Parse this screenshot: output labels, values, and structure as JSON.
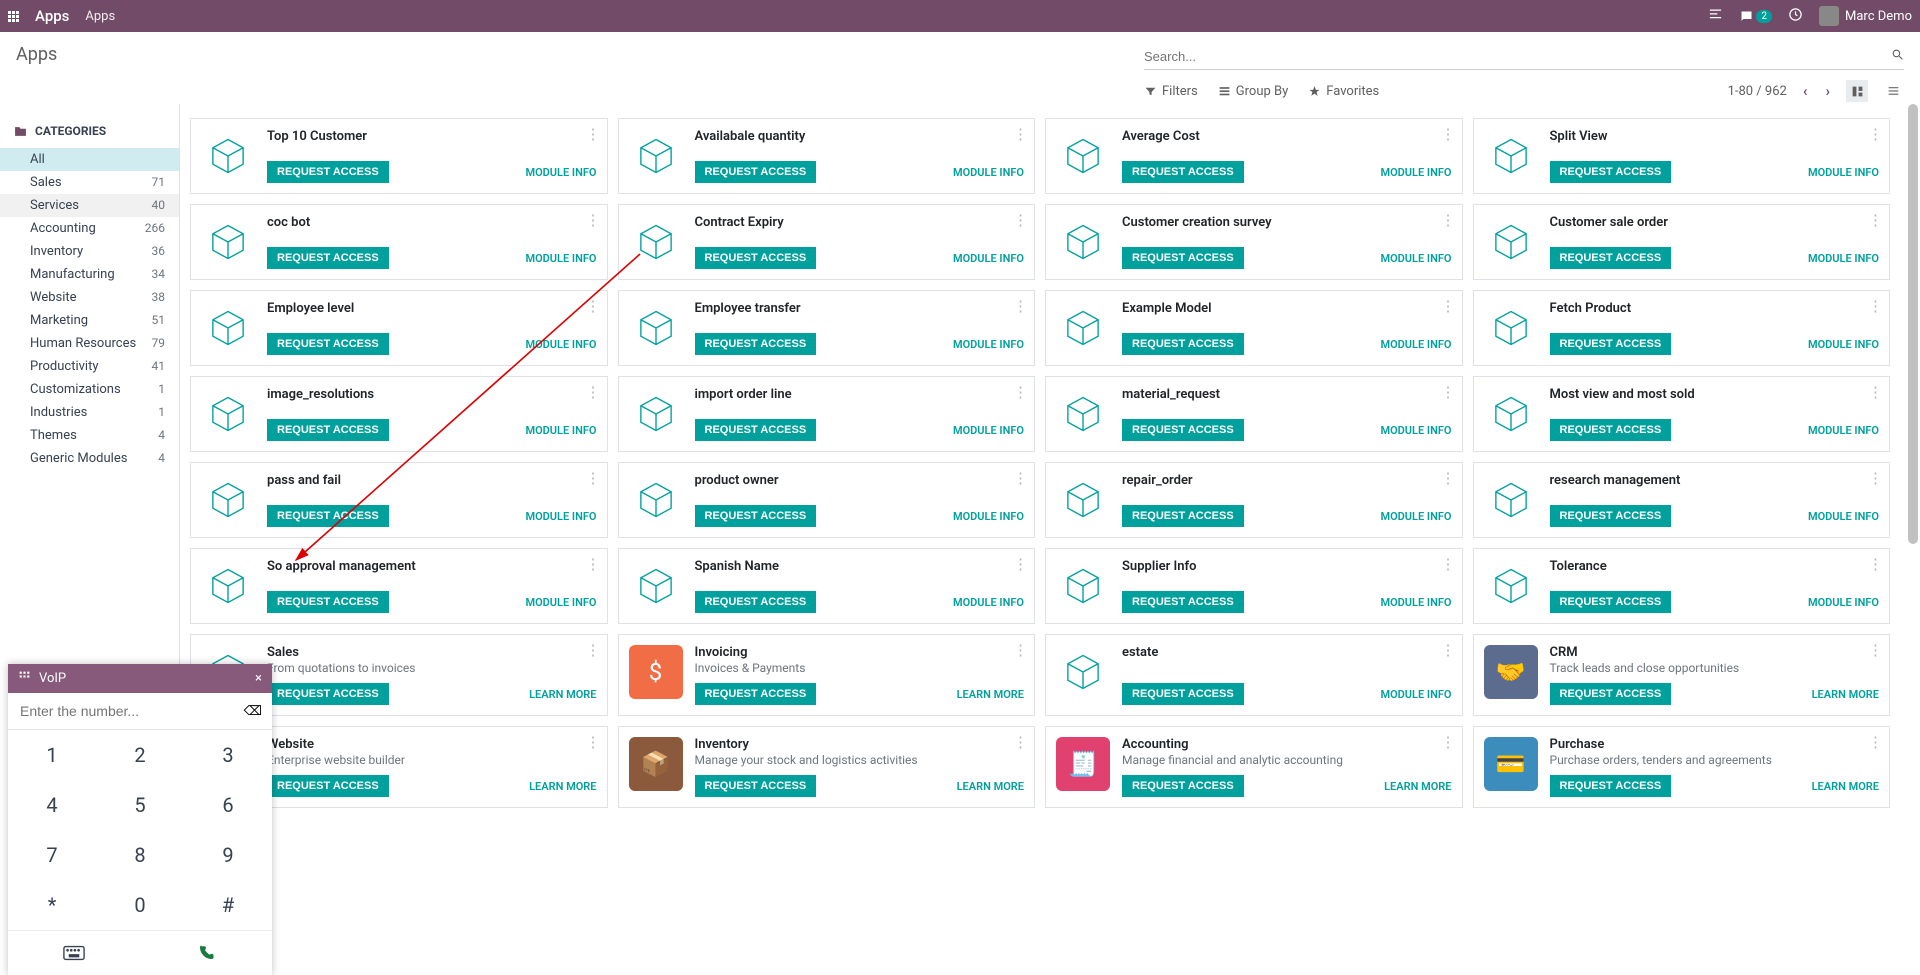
{
  "topbar": {
    "brand": "Apps",
    "crumb": "Apps",
    "user": "Marc Demo",
    "msg_badge": "2"
  },
  "page": {
    "title": "Apps",
    "search_placeholder": "Search..."
  },
  "controls": {
    "filters": "Filters",
    "groupby": "Group By",
    "favorites": "Favorites",
    "pager": "1-80 / 962"
  },
  "sidebar": {
    "header": "CATEGORIES",
    "items": [
      {
        "label": "All",
        "count": "",
        "sel": true
      },
      {
        "label": "Sales",
        "count": "71"
      },
      {
        "label": "Services",
        "count": "40",
        "hov": true
      },
      {
        "label": "Accounting",
        "count": "266"
      },
      {
        "label": "Inventory",
        "count": "36"
      },
      {
        "label": "Manufacturing",
        "count": "34"
      },
      {
        "label": "Website",
        "count": "38"
      },
      {
        "label": "Marketing",
        "count": "51"
      },
      {
        "label": "Human Resources",
        "count": "79"
      },
      {
        "label": "Productivity",
        "count": "41"
      },
      {
        "label": "Customizations",
        "count": "1"
      },
      {
        "label": "Industries",
        "count": "1"
      },
      {
        "label": "Themes",
        "count": "4"
      },
      {
        "label": "Generic Modules",
        "count": "4"
      }
    ]
  },
  "labels": {
    "request": "REQUEST ACCESS",
    "module_info": "MODULE INFO",
    "learn_more": "LEARN MORE"
  },
  "cards": [
    {
      "title": "Top 10 Customer",
      "link": "module_info",
      "icon": "cube"
    },
    {
      "title": "Availabale quantity",
      "link": "module_info",
      "icon": "cube"
    },
    {
      "title": "Average Cost",
      "link": "module_info",
      "icon": "cube"
    },
    {
      "title": "Split View",
      "link": "module_info",
      "icon": "cube"
    },
    {
      "title": "coc bot",
      "link": "module_info",
      "icon": "cube"
    },
    {
      "title": "Contract Expiry",
      "link": "module_info",
      "icon": "cube"
    },
    {
      "title": "Customer creation survey",
      "link": "module_info",
      "icon": "cube"
    },
    {
      "title": "Customer sale order",
      "link": "module_info",
      "icon": "cube"
    },
    {
      "title": "Employee level",
      "link": "module_info",
      "icon": "cube"
    },
    {
      "title": "Employee transfer",
      "link": "module_info",
      "icon": "cube"
    },
    {
      "title": "Example Model",
      "link": "module_info",
      "icon": "cube"
    },
    {
      "title": "Fetch Product",
      "link": "module_info",
      "icon": "cube"
    },
    {
      "title": "image_resolutions",
      "link": "module_info",
      "icon": "cube"
    },
    {
      "title": "import order line",
      "link": "module_info",
      "icon": "cube"
    },
    {
      "title": "material_request",
      "link": "module_info",
      "icon": "cube"
    },
    {
      "title": "Most view and most sold",
      "link": "module_info",
      "icon": "cube"
    },
    {
      "title": "pass and fail",
      "link": "module_info",
      "icon": "cube"
    },
    {
      "title": "product owner",
      "link": "module_info",
      "icon": "cube"
    },
    {
      "title": "repair_order",
      "link": "module_info",
      "icon": "cube"
    },
    {
      "title": "research management",
      "link": "module_info",
      "icon": "cube"
    },
    {
      "title": "So approval management",
      "link": "module_info",
      "icon": "cube"
    },
    {
      "title": "Spanish Name",
      "link": "module_info",
      "icon": "cube"
    },
    {
      "title": "Supplier Info",
      "link": "module_info",
      "icon": "cube"
    },
    {
      "title": "Tolerance",
      "link": "module_info",
      "icon": "cube"
    },
    {
      "title": "Sales",
      "sub": "From quotations to invoices",
      "link": "learn_more",
      "icon": "cube"
    },
    {
      "title": "Invoicing",
      "sub": "Invoices & Payments",
      "link": "learn_more",
      "icon": "sq",
      "cls": "sq-orange",
      "glyph": "$"
    },
    {
      "title": "estate",
      "link": "module_info",
      "icon": "cube"
    },
    {
      "title": "CRM",
      "sub": "Track leads and close opportunities",
      "link": "learn_more",
      "icon": "sq",
      "cls": "sq-darkblue",
      "glyph": "🤝"
    },
    {
      "title": "Website",
      "sub": "Enterprise website builder",
      "link": "learn_more",
      "icon": "cube"
    },
    {
      "title": "Inventory",
      "sub": "Manage your stock and logistics activities",
      "link": "learn_more",
      "icon": "sq",
      "cls": "sq-brown",
      "glyph": "📦"
    },
    {
      "title": "Accounting",
      "sub": "Manage financial and analytic accounting",
      "link": "learn_more",
      "icon": "sq",
      "cls": "sq-pink",
      "glyph": "🧾"
    },
    {
      "title": "Purchase",
      "sub": "Purchase orders, tenders and agreements",
      "link": "learn_more",
      "icon": "sq",
      "cls": "sq-blue",
      "glyph": "💳"
    }
  ],
  "voip": {
    "title": "VoIP",
    "placeholder": "Enter the number...",
    "keys": [
      "1",
      "2",
      "3",
      "4",
      "5",
      "6",
      "7",
      "8",
      "9",
      "*",
      "0",
      "#"
    ]
  }
}
